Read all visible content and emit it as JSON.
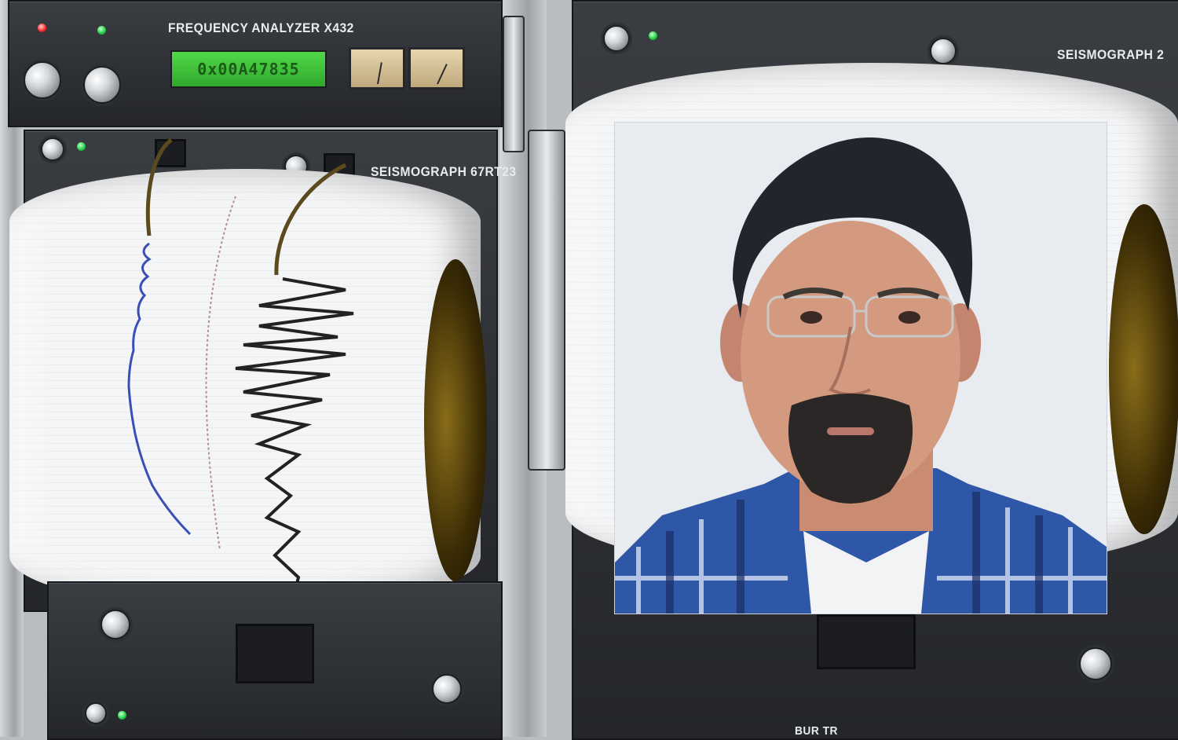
{
  "left_unit": {
    "top_panel_title": "FREQUENCY ANALYZER X432",
    "lcd_readout": "0x00A47835",
    "seismograph_title": "SEISMOGRAPH 67RT23"
  },
  "right_unit": {
    "seismograph_title": "SEISMOGRAPH 2"
  },
  "bottom_right": {
    "partial_label": "BUR TR"
  },
  "colors": {
    "panel": "#2f3236",
    "lcd_green": "#43c53d",
    "led_green": "#27d24a",
    "led_red": "#ff2e2e",
    "trace_blue": "#3a4fb5",
    "trace_black": "#222222",
    "photo_background": "#e8ebef",
    "shirt_blue": "#2f57a8"
  },
  "icons": [
    "knob-icon",
    "led-icon",
    "meter-icon",
    "pen-arm-icon"
  ]
}
